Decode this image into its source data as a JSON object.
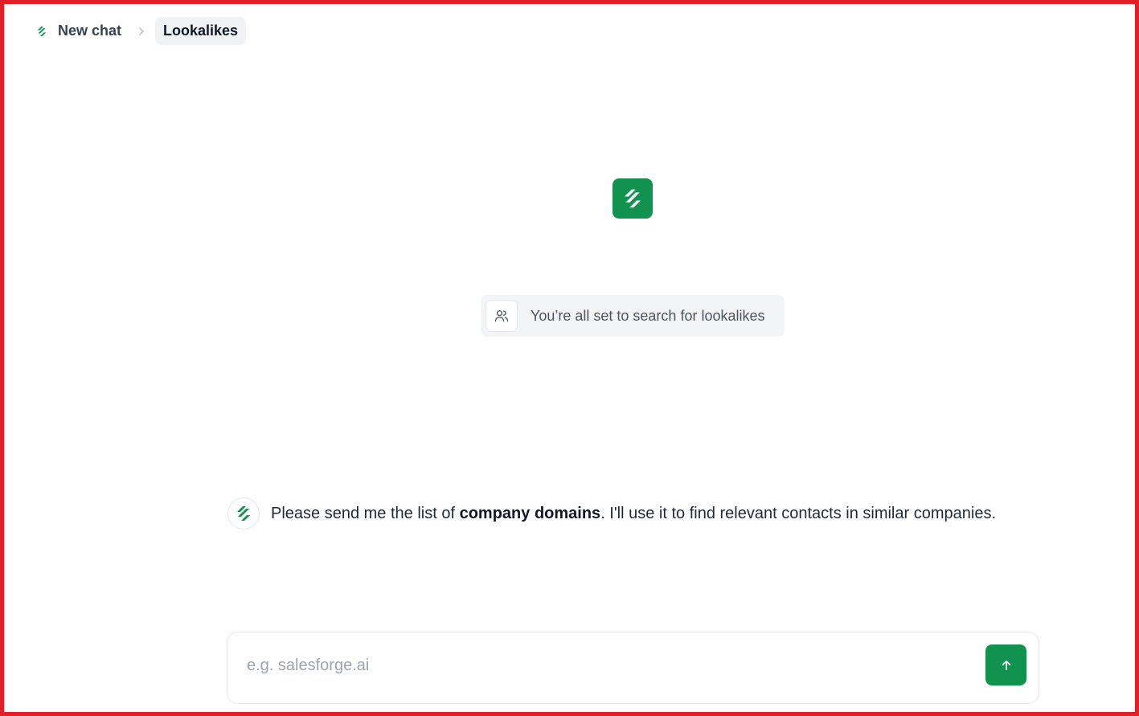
{
  "breadcrumb": {
    "home_label": "New chat",
    "current_label": "Lookalikes"
  },
  "status": {
    "text": "You’re all set to search for lookalikes"
  },
  "message": {
    "text_before": "Please send me the list of ",
    "text_bold": "company domains",
    "text_after": ". I'll use it to find relevant contacts in similar companies."
  },
  "composer": {
    "placeholder": "e.g. salesforge.ai",
    "value": ""
  },
  "colors": {
    "brand": "#12924f",
    "frame": "#e21f26"
  },
  "icons": {
    "brand": "salesforge-logo-icon",
    "chevron": "chevron-right-icon",
    "users": "users-icon",
    "send": "arrow-up-icon"
  }
}
